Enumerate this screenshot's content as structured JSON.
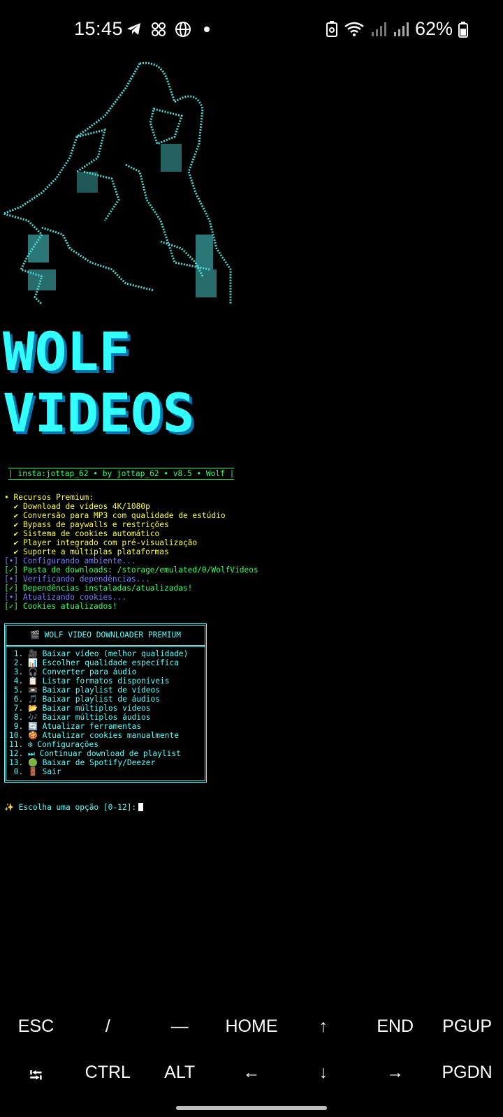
{
  "status_bar": {
    "time": "15:45",
    "battery": "62%"
  },
  "logo": {
    "line1": "WOLF",
    "line2": "VIDEOS"
  },
  "banner": "| insta:jottap_62 • by jottap_62 • v8.5 • Wolf |",
  "log": [
    {
      "text": "• Recursos Premium:",
      "color": "yellow"
    },
    {
      "text": "  ✔ Download de vídeos 4K/1080p",
      "color": "yellow"
    },
    {
      "text": "  ✔ Conversão para MP3 com qualidade de estúdio",
      "color": "yellow"
    },
    {
      "text": "  ✔ Bypass de paywalls e restrições",
      "color": "yellow"
    },
    {
      "text": "  ✔ Sistema de cookies automático",
      "color": "yellow"
    },
    {
      "text": "  ✔ Player integrado com pré-visualização",
      "color": "yellow"
    },
    {
      "text": "  ✔ Suporte a múltiplas plataformas",
      "color": "yellow"
    },
    {
      "text": "[•] Configurando ambiente...",
      "color": "blue"
    },
    {
      "text": "[✓] Pasta de downloads: /storage/emulated/0/WolfVideos",
      "color": "green"
    },
    {
      "text": "[•] Verificando dependências...",
      "color": "blue"
    },
    {
      "text": "[✓] Dependências instaladas/atualizadas!",
      "color": "green"
    },
    {
      "text": "[•] Atualizando cookies...",
      "color": "blue"
    },
    {
      "text": "[✓] Cookies atualizados!",
      "color": "green"
    }
  ],
  "menu": {
    "title": "🎬 WOLF VIDEO DOWNLOADER PREMIUM",
    "items": [
      " 1. 🎥 Baixar vídeo (melhor qualidade)",
      " 2. 📊 Escolher qualidade específica",
      " 3. 🎧 Converter para áudio",
      " 4. 📋 Listar formatos disponíveis",
      " 5. 📼 Baixar playlist de vídeos",
      " 6. 🎵 Baixar playlist de áudios",
      " 7. 📂 Baixar múltiplos vídeos",
      " 8. 🎶 Baixar múltiplos áudios",
      " 9. 🔄 Atualizar ferramentas",
      "10. 🍪 Atualizar cookies manualmente",
      "11. ⚙ Configurações",
      "12. ⏭ Continuar download de playlist",
      "13. 🟢 Baixar de Spotify/Deezer",
      " 0. 🚪 Sair"
    ]
  },
  "prompt": "✨ Escolha uma opção [0-12]:",
  "keys": {
    "row1": [
      "ESC",
      "/",
      "—",
      "HOME",
      "↑",
      "END",
      "PGUP"
    ],
    "row2": [
      "⭾",
      "CTRL",
      "ALT",
      "←",
      "↓",
      "→",
      "PGDN"
    ]
  }
}
